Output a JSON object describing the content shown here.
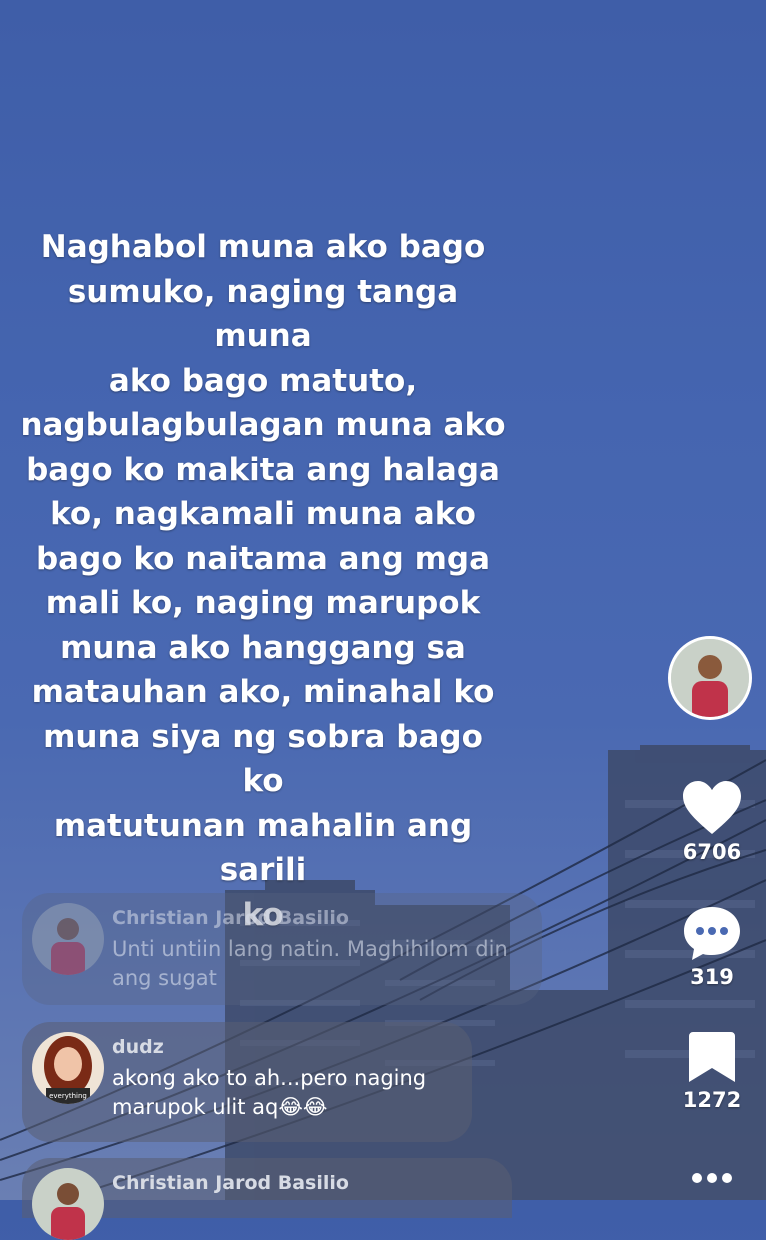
{
  "caption": "Naghabol muna ako bago\nsumuko, naging tanga muna\nako bago matuto,\nnagbulagbulagan muna ako\nbago ko makita ang halaga\nko, nagkamali muna ako\nbago ko naitama ang mga\nmali ko, naging marupok\nmuna ako hanggang sa\nmatauhan ako, minahal ko\nmuna siya ng sobra bago ko\nmatutunan mahalin ang sarili\nko",
  "rail": {
    "likes": "6706",
    "comments": "319",
    "saves": "1272",
    "like_icon": "heart-icon",
    "comment_icon": "speech-bubble-icon",
    "save_icon": "bookmark-icon",
    "more_icon": "more-dots-icon"
  },
  "comments": [
    {
      "name": "Christian Jarod Basilio",
      "text": "Unti untiin lang natin. Maghihilom din ang sugat"
    },
    {
      "name": "dudz",
      "text": "akong ako to ah...pero naging marupok ulit aq😂😂",
      "avatar_label": "everything"
    },
    {
      "name": "Christian Jarod Basilio",
      "text": ""
    }
  ],
  "colors": {
    "sky": "#4565b0",
    "text": "#ffffff",
    "avatar_shirt": "#c0334a"
  }
}
